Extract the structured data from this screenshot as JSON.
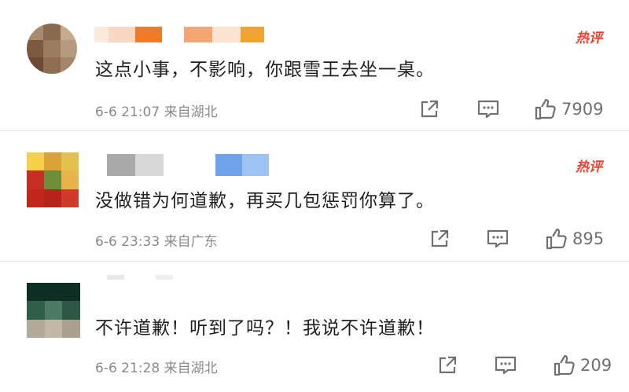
{
  "comments": [
    {
      "text": "这点小事，不影响，你跟雪王去坐一桌。",
      "meta": "6-6 21:07 来自湖北",
      "hot": "热评",
      "likes": "7909"
    },
    {
      "text": "没做错为何道歉，再买几包惩罚你算了。",
      "meta": "6-6 23:33 来自广东",
      "hot": "热评",
      "likes": "895"
    },
    {
      "text": "不许道歉！听到了吗？！我说不许道歉！",
      "meta": "6-6 21:28 来自湖北",
      "likes": "209"
    }
  ],
  "icons": {
    "share": "share-icon",
    "comment": "comment-icon",
    "like": "thumbs-up-icon"
  },
  "colors": {
    "hot_badge": "#e8432e",
    "meta_text": "#8a8a8a",
    "icon": "#707070"
  }
}
